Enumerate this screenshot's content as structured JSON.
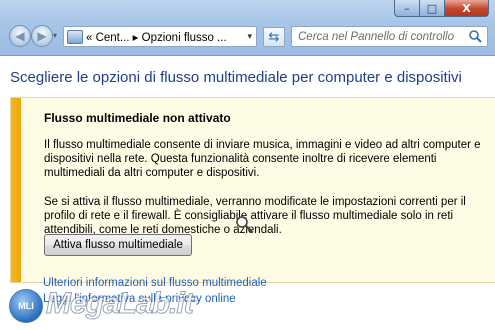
{
  "window": {
    "minimize": "–",
    "maximize": "□",
    "close": "X"
  },
  "nav": {
    "back": "◀",
    "forward": "▶"
  },
  "address": {
    "breadcrumb": "«  Cent... ▸ Opzioni flusso ...",
    "dropdown": "▾"
  },
  "search": {
    "placeholder": "Cerca nel Pannello di controllo"
  },
  "page": {
    "heading": "Scegliere le opzioni di flusso multimediale per computer e dispositivi"
  },
  "panel": {
    "title": "Flusso multimediale non attivato",
    "paragraph1": "Il flusso multimediale consente di inviare musica, immagini e video ad altri computer e dispositivi nella rete. Questa funzionalità consente inoltre di ricevere elementi multimediali da altri computer e dispositivi.",
    "paragraph2": "Se si attiva il flusso multimediale, verranno modificate le impostazioni correnti per il profilo di rete e il firewall. È consigliabile attivare il flusso multimediale solo in reti attendibili, come le reti domestiche o aziendali.",
    "button": "Attiva flusso multimediale",
    "accent_color": "#f5b21a"
  },
  "links": {
    "more_info": "Ulteriori informazioni sul flusso multimediale",
    "privacy": "Leggi l'informativa sulla privacy online"
  },
  "watermark": {
    "badge": "MLI",
    "text": "MegaLab.it"
  }
}
